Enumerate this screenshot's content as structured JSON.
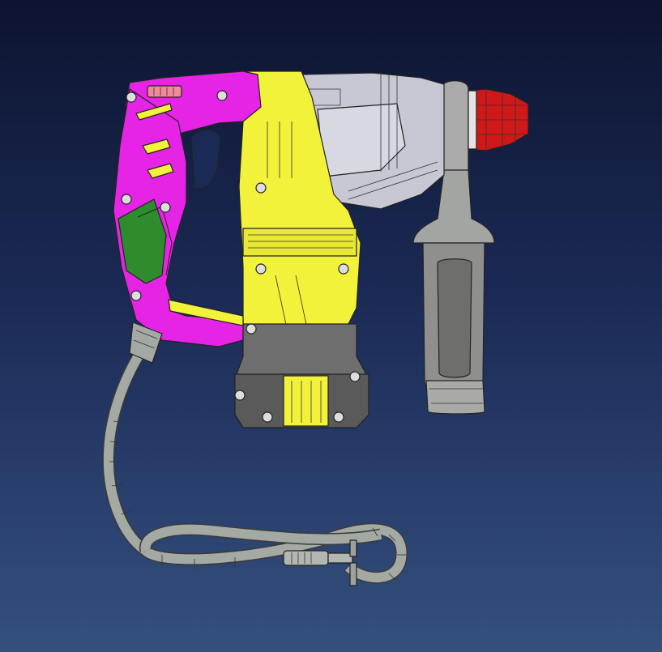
{
  "viewport": {
    "background_top": "#0d1430",
    "background_bottom": "#34507c"
  },
  "model": {
    "parts": [
      {
        "name": "rear-handle-housing",
        "color": "#e624e6"
      },
      {
        "name": "grip-overmold",
        "color": "#2e8b2e"
      },
      {
        "name": "motor-housing",
        "color": "#f2f23a"
      },
      {
        "name": "gear-housing",
        "color": "#c8c8d4"
      },
      {
        "name": "motor-base-cap",
        "color": "#6e6e6e"
      },
      {
        "name": "side-handle",
        "color": "#9a9a9a"
      },
      {
        "name": "side-handle-collar",
        "color": "#a9aaa9"
      },
      {
        "name": "chuck",
        "color": "#d01818"
      },
      {
        "name": "power-cord",
        "color": "#a4aaa3"
      },
      {
        "name": "plug",
        "color": "#b4b6b2"
      }
    ]
  }
}
